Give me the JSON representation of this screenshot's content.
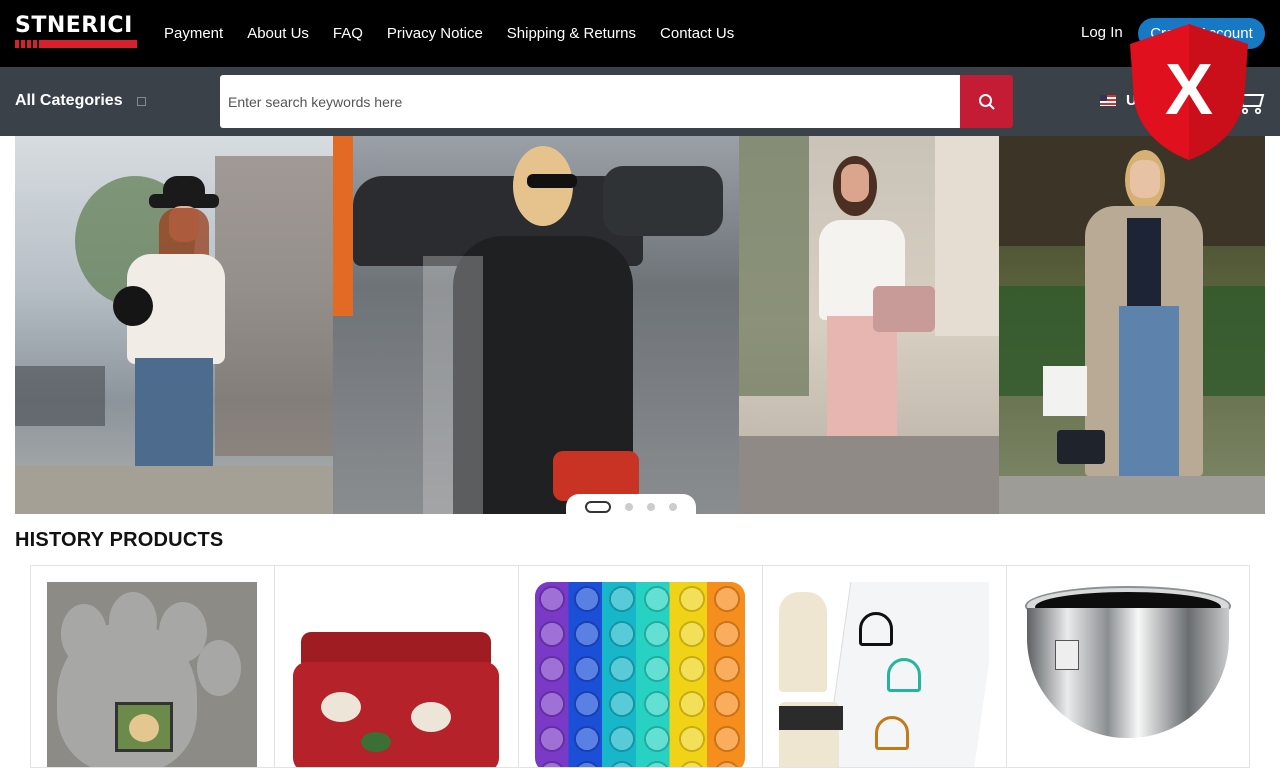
{
  "header": {
    "logo_text": "STNERICI",
    "nav": [
      "Payment",
      "About Us",
      "FAQ",
      "Privacy Notice",
      "Shipping & Returns",
      "Contact Us"
    ],
    "login_label": "Log In",
    "create_account_label": "Create Account"
  },
  "search": {
    "categories_label": "All Categories",
    "placeholder": "Enter search keywords here",
    "button_icon": "search-icon",
    "currency_label": "USD"
  },
  "colors": {
    "topbar": "#000000",
    "searchbar": "#3a4149",
    "accent_red": "#c41c34",
    "create_button": "#1779c4",
    "shield_red": "#e0101e"
  },
  "overlay": {
    "shield_letter": "X"
  },
  "banner": {
    "slides_count": 4,
    "active_slide": 1
  },
  "history": {
    "title": "HISTORY PRODUCTS",
    "products": [
      {
        "name": "Paw print memorial stone photo frame"
      },
      {
        "name": "Red Christmas bedding set"
      },
      {
        "name": "Rainbow push pop bubble toy"
      },
      {
        "name": "Badminton rubber stamps"
      },
      {
        "name": "Stainless steel mixing bowl"
      }
    ]
  }
}
